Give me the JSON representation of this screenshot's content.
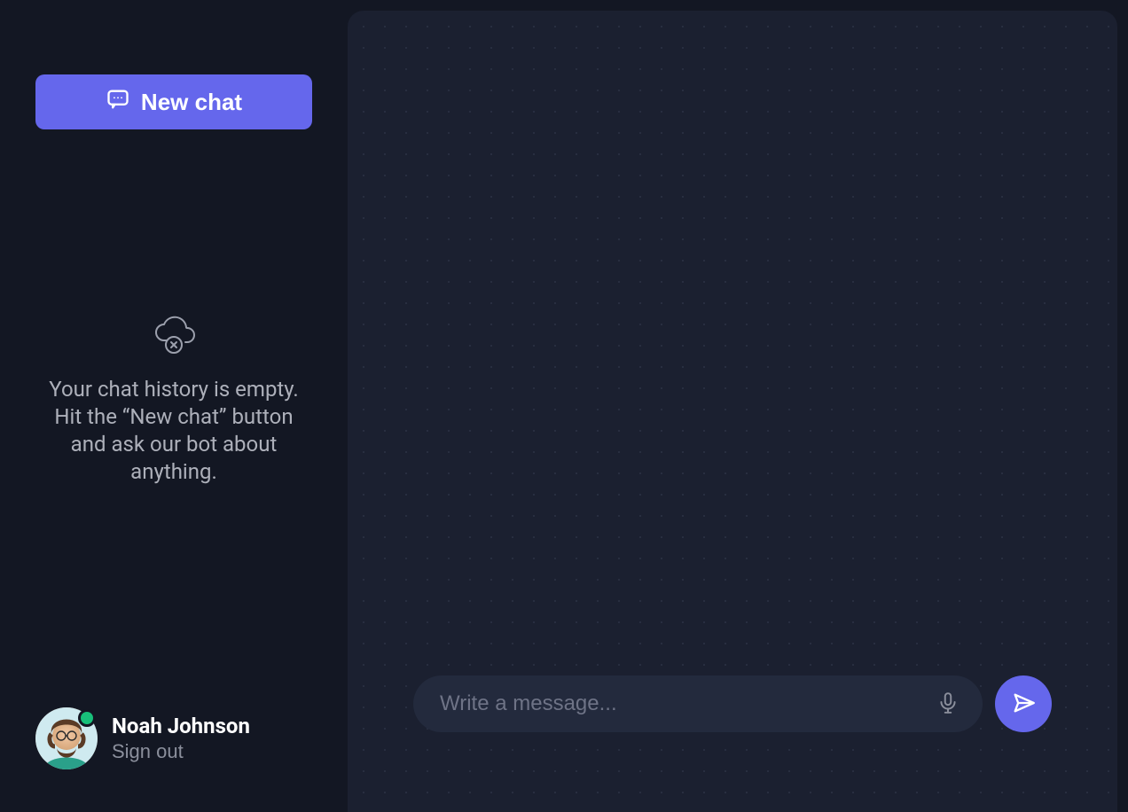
{
  "sidebar": {
    "new_chat_label": "New chat",
    "empty_state_text": "Your chat history is empty. Hit the “New chat” button and ask our bot about anything."
  },
  "user": {
    "name": "Noah Johnson",
    "signout_label": "Sign out",
    "status": "online"
  },
  "composer": {
    "placeholder": "Write a message..."
  },
  "icons": {
    "chat": "chat-bubble",
    "cloud_empty": "cloud-x",
    "mic": "microphone",
    "send": "paper-plane"
  },
  "colors": {
    "accent": "#6567ec",
    "bg_outer": "#131723",
    "bg_panel": "#1b2030",
    "input_bg": "#232a3d",
    "status_online": "#18c07a"
  }
}
